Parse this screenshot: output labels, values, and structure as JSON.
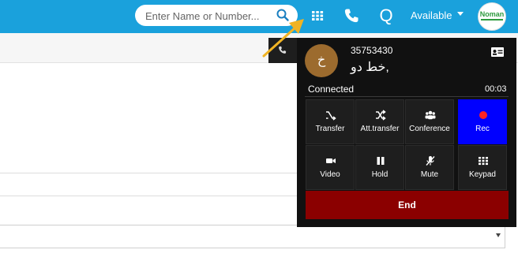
{
  "header": {
    "search_placeholder": "Enter Name or Number...",
    "status_label": "Available",
    "avatar_label": "Noman"
  },
  "call": {
    "avatar_initial": "خ",
    "number": "35753430",
    "name": "خط دو,",
    "state": "Connected",
    "timer": "00:03",
    "buttons": {
      "transfer": "Transfer",
      "att_transfer": "Att.transfer",
      "conference": "Conference",
      "rec": "Rec",
      "video": "Video",
      "hold": "Hold",
      "mute": "Mute",
      "keypad": "Keypad"
    },
    "end_label": "End"
  },
  "colors": {
    "topbar": "#1aa1dc",
    "panel_bg": "#111111",
    "rec_active": "#0000ff",
    "end": "#8b0000",
    "annotation_arrow": "#f0b323"
  }
}
